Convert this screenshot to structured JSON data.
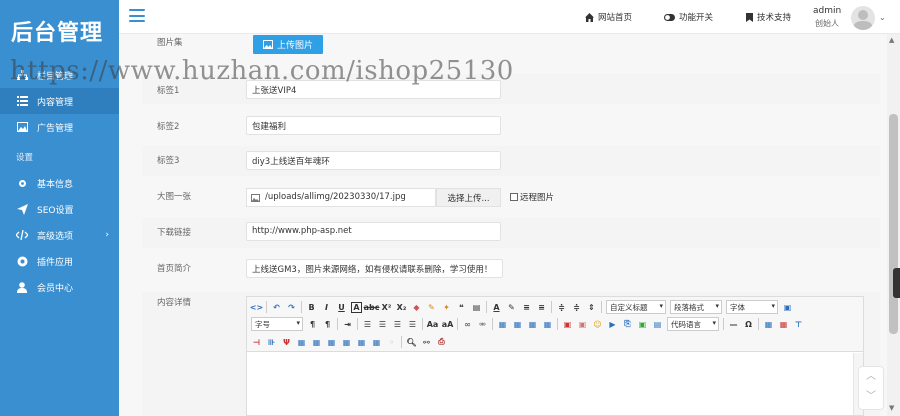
{
  "logo": "后台管理",
  "sidebar": {
    "items": [
      {
        "label": "栏目管理",
        "icon": "sitemap-icon"
      },
      {
        "label": "内容管理",
        "icon": "list-icon"
      },
      {
        "label": "广告管理",
        "icon": "image-icon"
      }
    ],
    "section": "设置",
    "settings": [
      {
        "label": "基本信息",
        "icon": "gear-icon"
      },
      {
        "label": "SEO设置",
        "icon": "send-icon"
      },
      {
        "label": "高级选项",
        "icon": "code-icon"
      },
      {
        "label": "插件应用",
        "icon": "puzzle-icon"
      },
      {
        "label": "会员中心",
        "icon": "user-icon"
      }
    ]
  },
  "topbar": {
    "site_home": "网站首页",
    "feature_toggle": "功能开关",
    "tech_support": "技术支持",
    "user_name": "admin",
    "user_role": "创始人"
  },
  "form": {
    "gallery_label": "图片集",
    "upload_button": "上传图片",
    "tag1_label": "标签1",
    "tag1_value": "上张送VIP4",
    "tag2_label": "标签2",
    "tag2_value": "包建福利",
    "tag3_label": "标签3",
    "tag3_value": "diy3上线送百年魂环",
    "bigimg_label": "大图一张",
    "bigimg_value": "/uploads/allimg/20230330/17.jpg",
    "choose_button": "选择上传...",
    "remote_label": "远程图片",
    "download_label": "下载链接",
    "download_value": "http://www.php-asp.net",
    "intro_label": "首页简介",
    "intro_value": "上线送GM3，图片来源网络，如有侵权请联系删除，学习使用！",
    "content_label": "内容详情"
  },
  "editor": {
    "sel_title": "自定义标题",
    "sel_para": "段落格式",
    "sel_font": "字体",
    "sel_size": "字号",
    "sel_lang": "代码语言"
  },
  "watermark": "https://www.huzhan.com/ishop25130",
  "colors": {
    "sidebar": "#3a8fd1",
    "accent": "#2f9fe6"
  }
}
